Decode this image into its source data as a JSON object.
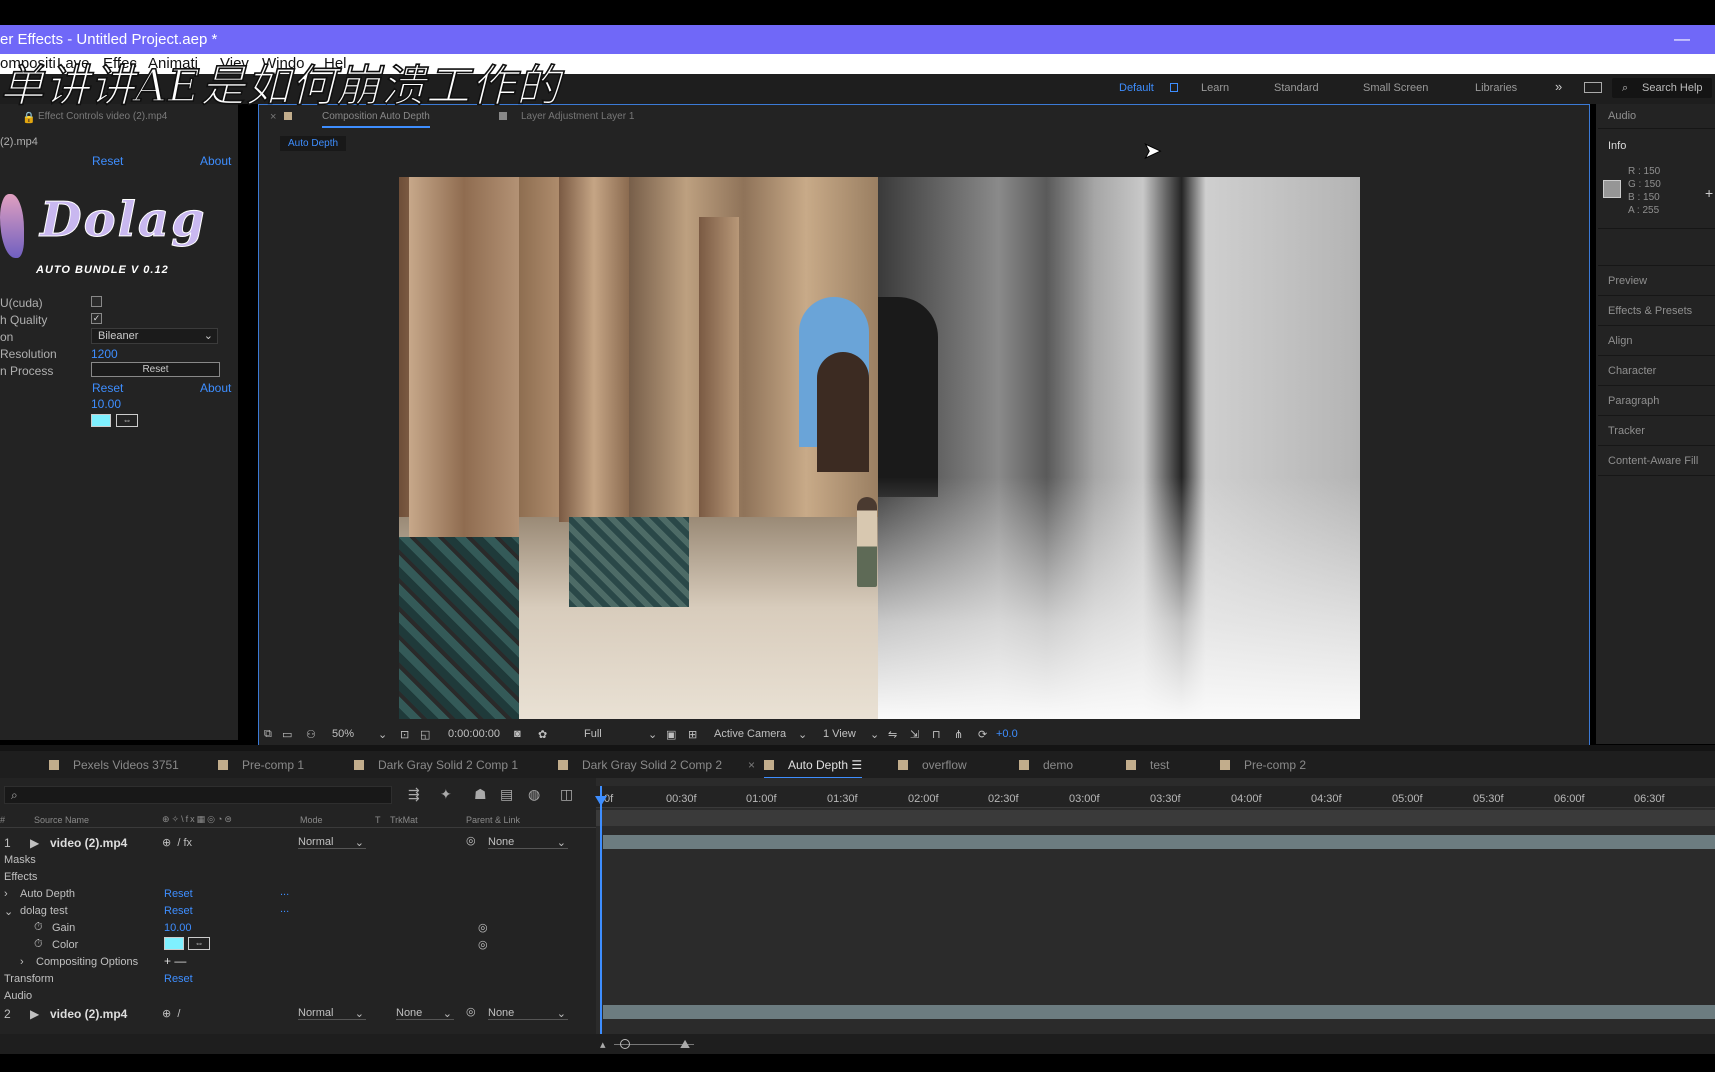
{
  "window": {
    "title": "er Effects - Untitled Project.aep *",
    "minimize": "—"
  },
  "menu": [
    "ompositi",
    "Laye",
    "Effec",
    "Animati",
    "Viev",
    "Windo",
    "Hel"
  ],
  "overlay_caption": "单讲讲AE是如何崩溃工作的",
  "workspaces": [
    "Default",
    "Learn",
    "Standard",
    "Small Screen",
    "Libraries"
  ],
  "search_help": "Search Help",
  "effect_controls": {
    "tab_label": "Effect Controls video (2).mp4",
    "layer_name": "(2).mp4",
    "reset": "Reset",
    "about": "About",
    "logo_title": "Dolag",
    "logo_sub": "AUTO BUNDLE V 0.12",
    "props": {
      "gpu_label": "U(cuda)",
      "quality_label": "h Quality",
      "interp_label": "on",
      "interp_value": "Bileaner",
      "res_label": "Resolution",
      "res_value": "1200",
      "process_label": "n Process",
      "process_button": "Reset",
      "reset2": "Reset",
      "about2": "About",
      "gain_value": "10.00"
    }
  },
  "composition": {
    "tab_label": "Composition Auto Depth",
    "layer_tab": "Layer Adjustment Layer 1",
    "subtab": "Auto Depth",
    "zoom": "50%",
    "timecode": "0:00:00:00",
    "resolution": "Full",
    "camera": "Active Camera",
    "views": "1 View",
    "exposure": "+0.0"
  },
  "right_panel": {
    "audio": "Audio",
    "info": "Info",
    "info_values": [
      "R : 150",
      "G : 150",
      "B : 150",
      "A : 255"
    ],
    "items": [
      "Preview",
      "Effects & Presets",
      "Align",
      "Character",
      "Paragraph",
      "Tracker",
      "Content-Aware Fill"
    ]
  },
  "timeline_tabs": [
    "Pexels Videos 3751",
    "Pre-comp 1",
    "Dark Gray Solid 2 Comp 1",
    "Dark Gray Solid 2 Comp 2",
    "Auto Depth",
    "overflow",
    "demo",
    "test",
    "Pre-comp 2"
  ],
  "ruler": [
    "0f",
    "00:30f",
    "01:00f",
    "01:30f",
    "02:00f",
    "02:30f",
    "03:00f",
    "03:30f",
    "04:00f",
    "04:30f",
    "05:00f",
    "05:30f",
    "06:00f",
    "06:30f"
  ],
  "columns": {
    "num": "#",
    "source": "Source Name",
    "mode": "Mode",
    "t": "T",
    "trkmat": "TrkMat",
    "parent": "Parent & Link"
  },
  "layers": {
    "l1_num": "1",
    "l1_name": "video (2).mp4",
    "l1_mode": "Normal",
    "l1_parent": "None",
    "masks": "Masks",
    "effects": "Effects",
    "auto_depth": "Auto Depth",
    "auto_depth_reset": "Reset",
    "dots1": "...",
    "dolag_test": "dolag test",
    "dolag_reset": "Reset",
    "dots2": "...",
    "gain": "Gain",
    "gain_value": "10.00",
    "color": "Color",
    "compositing": "Compositing Options",
    "comp_plusminus": "+ —",
    "transform": "Transform",
    "transform_reset": "Reset",
    "audio": "Audio",
    "l2_num": "2",
    "l2_name": "video (2).mp4",
    "l2_mode": "Normal",
    "l2_trkmat": "None",
    "l2_parent": "None"
  },
  "colors": {
    "accent": "#3e8eff",
    "titlebar": "#7068f8",
    "swatch": "#7ff0ff"
  }
}
